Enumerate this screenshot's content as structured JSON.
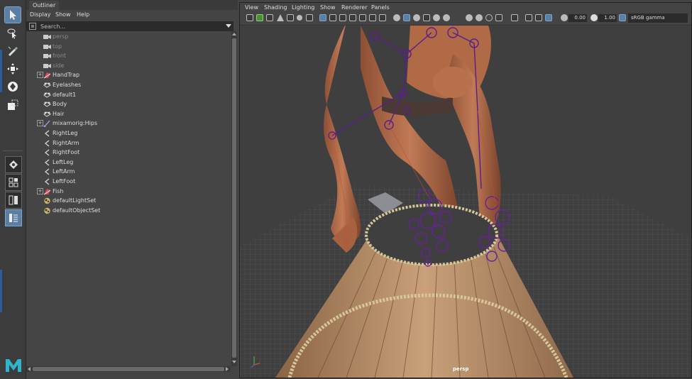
{
  "toolbox": {
    "tools": [
      {
        "name": "select-tool",
        "icon": "arrow-cursor-icon",
        "active": true
      },
      {
        "name": "lasso-tool",
        "icon": "lasso-cursor-icon",
        "active": false
      },
      {
        "name": "paint-select-tool",
        "icon": "brush-icon",
        "active": false
      },
      {
        "name": "move-tool",
        "icon": "move-arrows-icon",
        "active": false
      },
      {
        "name": "rotate-tool",
        "icon": "rotate-icon",
        "active": false
      },
      {
        "name": "scale-tool",
        "icon": "scale-icon",
        "active": false
      }
    ],
    "logo": "maya-logo-icon"
  },
  "outliner": {
    "tab_label": "Outliner",
    "menu": [
      "Display",
      "Show",
      "Help"
    ],
    "search": {
      "placeholder": "Search..."
    },
    "items": [
      {
        "label": "persp",
        "icon": "camera-icon",
        "expandable": false,
        "dim": true
      },
      {
        "label": "top",
        "icon": "camera-icon",
        "expandable": false,
        "dim": true
      },
      {
        "label": "front",
        "icon": "camera-icon",
        "expandable": false,
        "dim": true
      },
      {
        "label": "side",
        "icon": "camera-icon",
        "expandable": false,
        "dim": true
      },
      {
        "label": "HandTrap",
        "icon": "mesh-icon",
        "expandable": true,
        "dim": false
      },
      {
        "label": "Eyelashes",
        "icon": "group-icon",
        "expandable": false,
        "dim": false
      },
      {
        "label": "default1",
        "icon": "group-icon",
        "expandable": false,
        "dim": false
      },
      {
        "label": "Body",
        "icon": "group-icon",
        "expandable": false,
        "dim": false
      },
      {
        "label": "Hair",
        "icon": "group-icon",
        "expandable": false,
        "dim": false
      },
      {
        "label": "mixamorig:Hips",
        "icon": "joint-icon",
        "expandable": true,
        "dim": false
      },
      {
        "label": "RightLeg",
        "icon": "ik-handle-icon",
        "expandable": false,
        "dim": false
      },
      {
        "label": "RightArm",
        "icon": "ik-handle-icon",
        "expandable": false,
        "dim": false
      },
      {
        "label": "RightFoot",
        "icon": "ik-handle-icon",
        "expandable": false,
        "dim": false
      },
      {
        "label": "LeftLeg",
        "icon": "ik-handle-icon",
        "expandable": false,
        "dim": false
      },
      {
        "label": "LeftArm",
        "icon": "ik-handle-icon",
        "expandable": false,
        "dim": false
      },
      {
        "label": "LeftFoot",
        "icon": "ik-handle-icon",
        "expandable": false,
        "dim": false
      },
      {
        "label": "Fish",
        "icon": "mesh-icon",
        "expandable": true,
        "dim": false
      },
      {
        "label": "defaultLightSet",
        "icon": "set-icon",
        "expandable": false,
        "dim": false
      },
      {
        "label": "defaultObjectSet",
        "icon": "set-icon",
        "expandable": false,
        "dim": false
      }
    ]
  },
  "viewport": {
    "menu": [
      "View",
      "Shading",
      "Lighting",
      "Show",
      "Renderer",
      "Panels"
    ],
    "exposure": "0.00",
    "gamma": "1.00",
    "color_space": "sRGB gamma",
    "camera_label": "persp"
  },
  "colors": {
    "accent": "#5a7fa3",
    "bg": "#444444",
    "joint": "#5a1e8c",
    "skin": "#b8714d",
    "wood": "#b98e66"
  }
}
